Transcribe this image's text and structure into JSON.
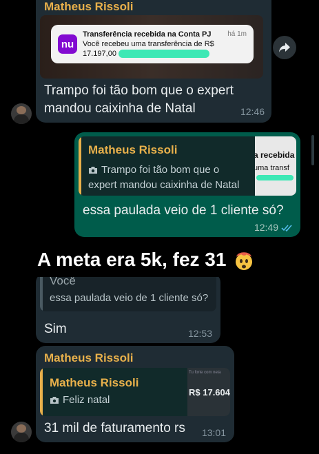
{
  "message1": {
    "sender": "Matheus Rissoli",
    "notification": {
      "title": "Transferência recebida na Conta PJ",
      "time_ago": "há 1m",
      "body_line1": "Você recebeu uma transferência de R$",
      "amount": "17.197,00",
      "app_logo": "nu"
    },
    "text_line1": "Trampo foi tão bom que o expert",
    "text_line2": "mandou caixinha de Natal",
    "time": "12:46"
  },
  "message2": {
    "quote_sender": "Matheus Rissoli",
    "quote_line1": "Trampo foi tão bom que o",
    "quote_line2": "expert mandou caixinha de Natal",
    "quote_thumb_text1": "a recebida n",
    "quote_thumb_text2": "uma transf",
    "text": "essa paulada veio de 1 cliente só?",
    "time": "12:49"
  },
  "overlay_caption": "A meta era 5k, fez 31",
  "message3": {
    "quote_sender": "Você",
    "quote_text": "essa paulada veio de 1 cliente só?",
    "text": "Sim",
    "time": "12:53"
  },
  "message4": {
    "sender": "Matheus Rissoli",
    "quote_sender": "Matheus Rissoli",
    "quote_text": "Feliz natal",
    "quote_thumb_amount": "R$ 17.604",
    "quote_thumb_small": "Tu forte com nela",
    "text": "31 mil de faturamento rs",
    "time": "13:01"
  },
  "icons": {
    "forward": "forward-arrow-icon",
    "camera": "camera-icon",
    "read_receipt": "double-check-icon",
    "emoji": "exploding-head-emoji"
  },
  "colors": {
    "incoming_bubble": "#1f2c34",
    "outgoing_bubble": "#005c4b",
    "sender_name": "#e8b04b",
    "read_ticks": "#53bdeb",
    "nubank_purple": "#820ad1"
  }
}
